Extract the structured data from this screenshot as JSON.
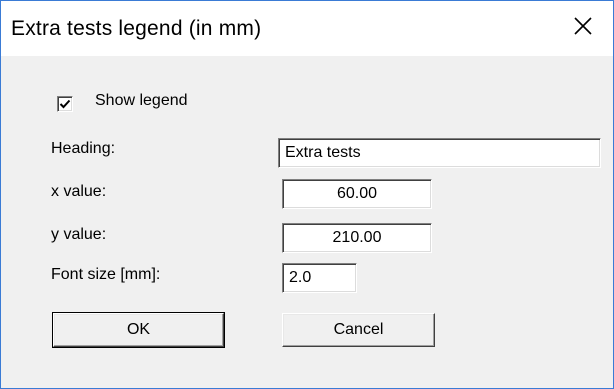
{
  "window": {
    "title": "Extra tests legend (in mm)"
  },
  "form": {
    "show_legend": {
      "label": "Show legend",
      "checked": true
    },
    "heading": {
      "label": "Heading:",
      "value": "Extra tests"
    },
    "x_value": {
      "label": "x value:",
      "value": "60.00"
    },
    "y_value": {
      "label": "y value:",
      "value": "210.00"
    },
    "font_size": {
      "label": "Font size [mm]:",
      "value": "2.0"
    }
  },
  "buttons": {
    "ok": "OK",
    "cancel": "Cancel"
  },
  "icons": {
    "close": "close-icon",
    "check": "checkmark-icon"
  }
}
